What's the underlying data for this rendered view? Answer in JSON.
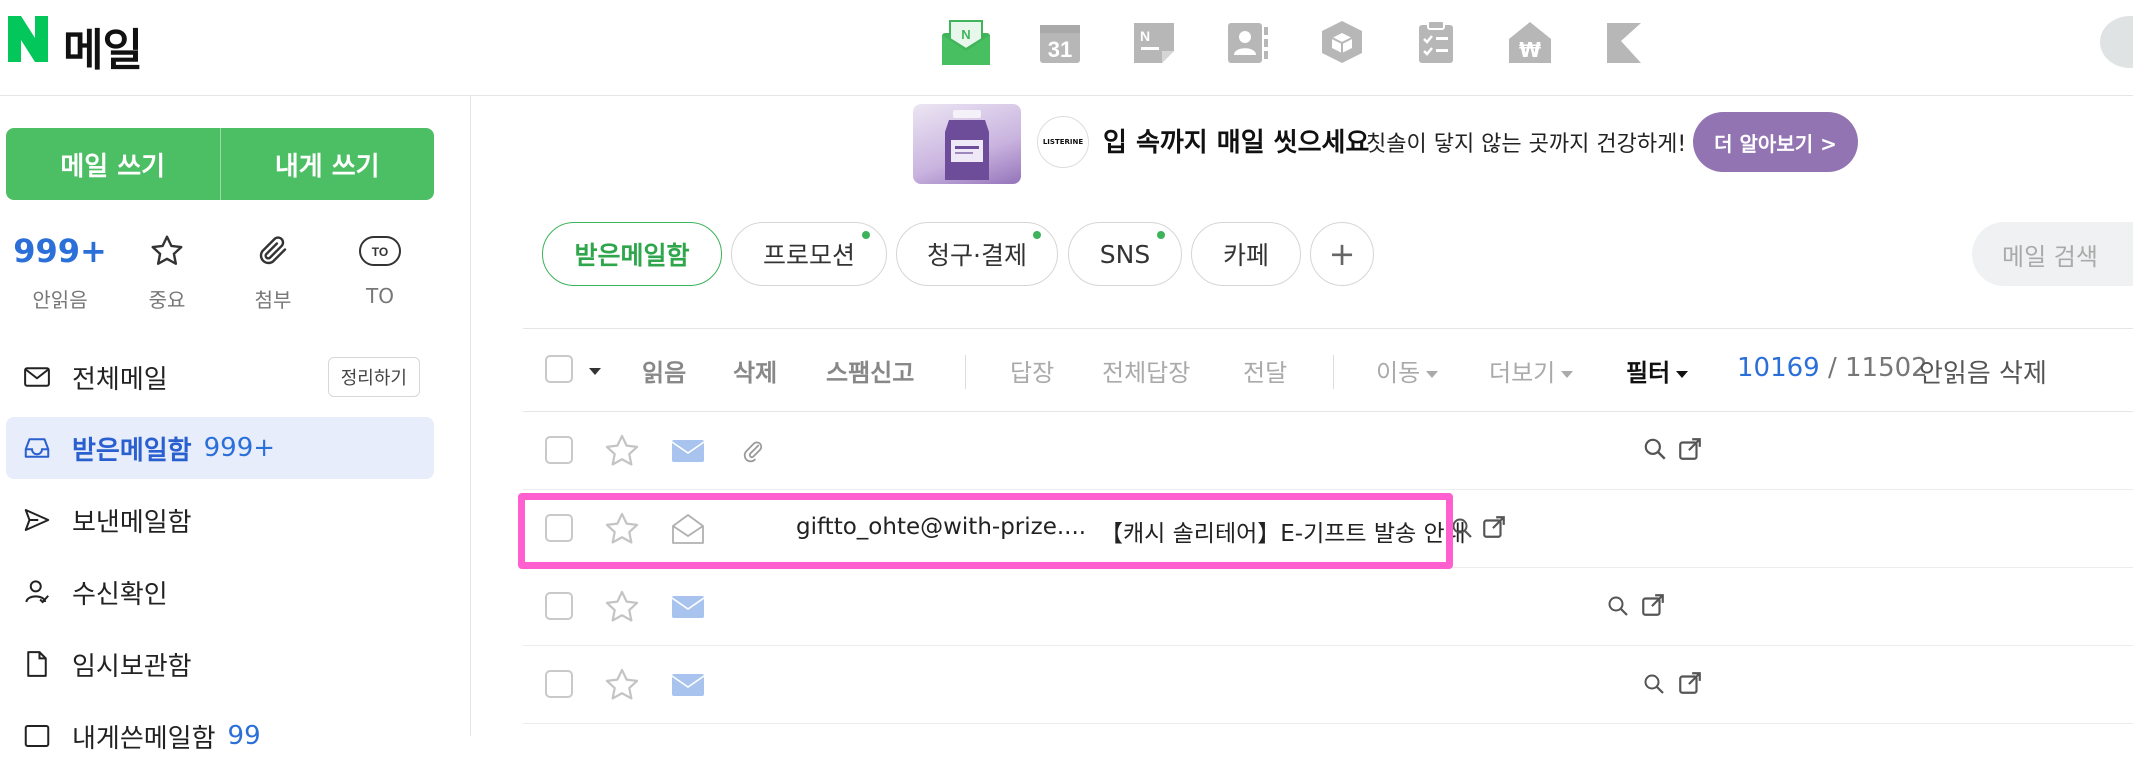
{
  "header": {
    "logo_mark": "N",
    "logo_text": "메일",
    "apps": [
      {
        "icon": "mail-app-icon"
      },
      {
        "icon": "calendar-icon",
        "text": "31"
      },
      {
        "icon": "memo-icon",
        "text": "N"
      },
      {
        "icon": "contacts-icon"
      },
      {
        "icon": "mybox-icon"
      },
      {
        "icon": "todo-icon"
      },
      {
        "icon": "household-ledger-icon",
        "text": "₩"
      },
      {
        "icon": "bookmark-icon"
      }
    ],
    "accent": "#03c75a"
  },
  "sidebar": {
    "write_mail": "메일 쓰기",
    "write_self": "내게 쓰기",
    "quick": [
      {
        "value": "999+",
        "label": "안읽음"
      },
      {
        "icon": "star-icon",
        "label": "중요"
      },
      {
        "icon": "paperclip-icon",
        "label": "첨부"
      },
      {
        "icon": "to-icon",
        "glyph": "TO",
        "label": "TO"
      }
    ],
    "items": [
      {
        "label": "전체메일",
        "icon": "mail-icon",
        "action": "정리하기"
      },
      {
        "label": "받은메일함",
        "count": "999+",
        "icon": "inbox-icon",
        "active": true
      },
      {
        "label": "보낸메일함",
        "icon": "send-icon"
      },
      {
        "label": "수신확인",
        "icon": "read-receipt-icon"
      },
      {
        "label": "임시보관함",
        "icon": "draft-icon"
      },
      {
        "label": "내게쓴메일함",
        "count": "99",
        "icon": "self-mail-icon"
      }
    ]
  },
  "banner": {
    "brand": "LISTERINE",
    "headline": "입 속까지 매일 씻으세요",
    "subtext": "칫솔이 닿지 않는 곳까지 건강하게!",
    "cta": "더 알아보기 >"
  },
  "tabs": [
    {
      "label": "받은메일함",
      "active": true
    },
    {
      "label": "프로모션",
      "dot": true
    },
    {
      "label": "청구·결제",
      "dot": true
    },
    {
      "label": "SNS",
      "dot": true
    },
    {
      "label": "카페"
    },
    {
      "label": "+"
    }
  ],
  "search": {
    "placeholder": "메일 검색"
  },
  "toolbar": {
    "read": "읽음",
    "delete": "삭제",
    "spam": "스팸신고",
    "reply": "답장",
    "reply_all": "전체답장",
    "forward": "전달",
    "move": "이동",
    "more": "더보기",
    "filter": "필터",
    "unread_count": "10169",
    "total_count": "/ 11502",
    "delete_unread": "안읽음 삭제"
  },
  "emails": [
    {
      "sender": "",
      "subject": "",
      "attachment": true,
      "unread": true
    },
    {
      "sender": "giftto_ohte@with-prize....",
      "subject": "【캐시 솔리테어】E-기프트 발송 안내",
      "unread": false,
      "highlighted": true
    },
    {
      "sender": "",
      "subject": "",
      "unread": true
    },
    {
      "sender": "",
      "subject": "",
      "unread": true
    }
  ],
  "colors": {
    "green": "#4cbe63",
    "blue": "#2b6fd8",
    "highlight": "#ff5fcf",
    "banner_button": "#9274b2"
  }
}
